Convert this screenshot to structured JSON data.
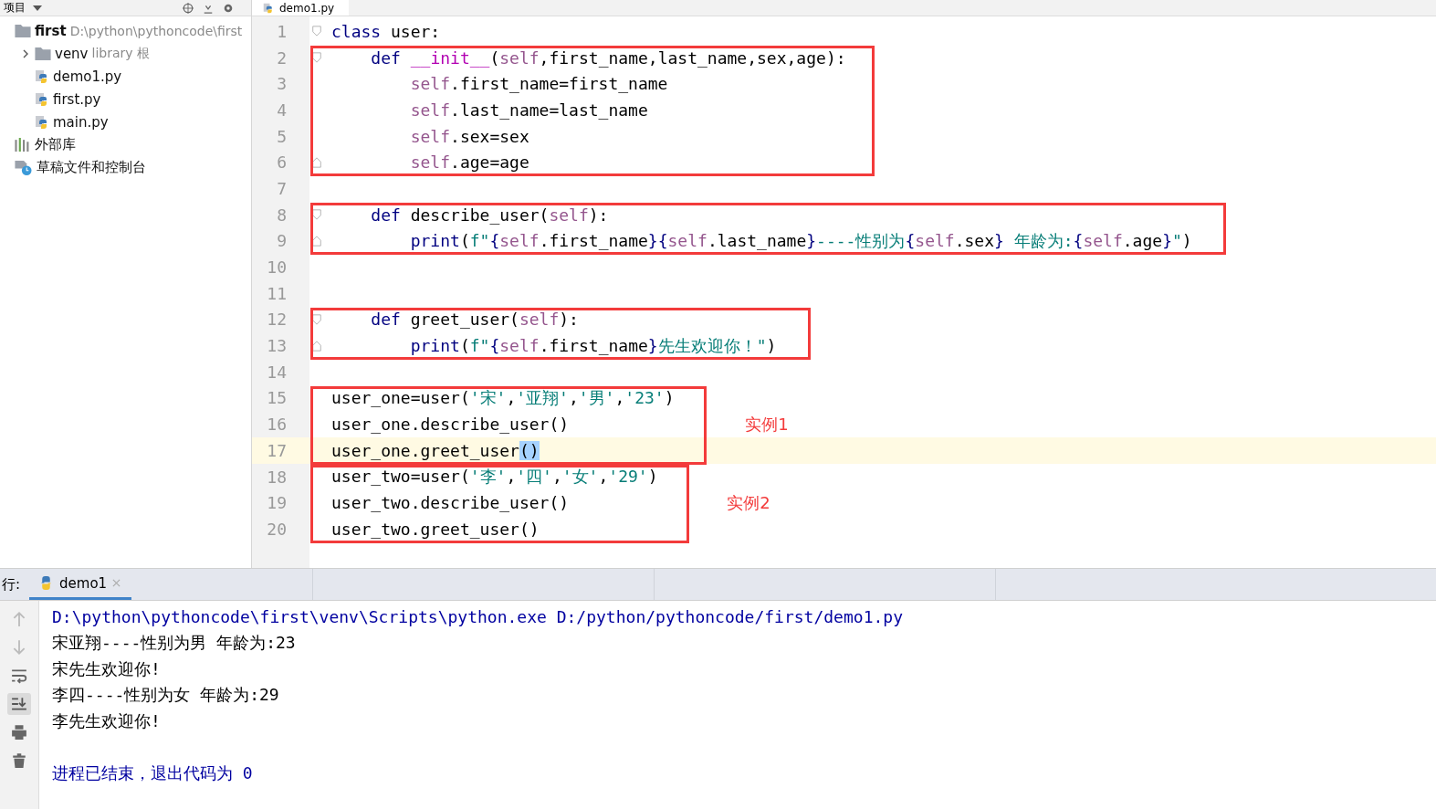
{
  "project_panel": {
    "title": "项目",
    "tree": [
      {
        "label": "first",
        "note": "D:\\python\\pythoncode\\first",
        "kind": "folder",
        "children": [
          {
            "label": "venv",
            "note": "library 根",
            "kind": "folder",
            "expanded": false
          },
          {
            "label": "demo1.py",
            "kind": "python"
          },
          {
            "label": "first.py",
            "kind": "python"
          },
          {
            "label": "main.py",
            "kind": "python"
          }
        ]
      },
      {
        "label": "外部库",
        "kind": "library"
      },
      {
        "label": "草稿文件和控制台",
        "kind": "scratch"
      }
    ]
  },
  "editor": {
    "tabs": [
      {
        "label": "demo1.py",
        "selected": true
      }
    ],
    "blocks": [
      {
        "kind": "plain",
        "lines": [
          {
            "number": "1",
            "kind": "fold-start",
            "current": false,
            "tokens": [
              {
                "t": "class",
                "kind": "kw"
              },
              {
                "t": " user:",
                "kind": "plain"
              }
            ]
          }
        ]
      },
      {
        "kind": "boxed",
        "lines": [
          {
            "number": "2",
            "kind": "fold-start",
            "current": false,
            "tokens": [
              {
                "t": "    def ",
                "kind": "kw"
              },
              {
                "t": "__init__",
                "kind": "magic"
              },
              {
                "t": "(",
                "kind": "plain"
              },
              {
                "t": "self",
                "kind": "self"
              },
              {
                "t": ",first_name,last_name,sex,age):",
                "kind": "plain"
              }
            ]
          },
          {
            "number": "3",
            "kind": "plain",
            "current": false,
            "tokens": [
              {
                "t": "        self",
                "kind": "self"
              },
              {
                "t": ".first_name=first_name",
                "kind": "plain"
              }
            ]
          },
          {
            "number": "4",
            "kind": "plain",
            "current": false,
            "tokens": [
              {
                "t": "        self",
                "kind": "self"
              },
              {
                "t": ".last_name=last_name",
                "kind": "plain"
              }
            ]
          },
          {
            "number": "5",
            "kind": "plain",
            "current": false,
            "tokens": [
              {
                "t": "        self",
                "kind": "self"
              },
              {
                "t": ".sex=sex",
                "kind": "plain"
              }
            ]
          },
          {
            "number": "6",
            "kind": "fold-end",
            "current": false,
            "tokens": [
              {
                "t": "        self",
                "kind": "self"
              },
              {
                "t": ".age=age",
                "kind": "plain"
              }
            ]
          }
        ]
      },
      {
        "kind": "plain",
        "lines": [
          {
            "number": "7",
            "kind": "plain",
            "current": false
          }
        ]
      },
      {
        "kind": "boxed",
        "lines": [
          {
            "number": "8",
            "kind": "fold-start",
            "current": false,
            "tokens": [
              {
                "t": "    def",
                "kind": "kw"
              },
              {
                "t": " describe_user(",
                "kind": "plain"
              },
              {
                "t": "self",
                "kind": "self"
              },
              {
                "t": "):",
                "kind": "plain"
              }
            ]
          },
          {
            "number": "9",
            "kind": "fold-end",
            "current": false,
            "tokens": [
              {
                "t": "        print",
                "kind": "builtin"
              },
              {
                "t": "(",
                "kind": "plain"
              },
              {
                "t": "f\"",
                "kind": "str"
              },
              {
                "t": "{",
                "kind": "brace"
              },
              {
                "t": "self",
                "kind": "self"
              },
              {
                "t": ".first_name",
                "kind": "plain"
              },
              {
                "t": "}{",
                "kind": "brace"
              },
              {
                "t": "self",
                "kind": "self"
              },
              {
                "t": ".last_name",
                "kind": "plain"
              },
              {
                "t": "}",
                "kind": "brace"
              },
              {
                "t": "----性别为",
                "kind": "str"
              },
              {
                "t": "{",
                "kind": "brace"
              },
              {
                "t": "self",
                "kind": "self"
              },
              {
                "t": ".sex",
                "kind": "plain"
              },
              {
                "t": "}",
                "kind": "brace"
              },
              {
                "t": " 年龄为:",
                "kind": "str"
              },
              {
                "t": "{",
                "kind": "brace"
              },
              {
                "t": "self",
                "kind": "self"
              },
              {
                "t": ".age",
                "kind": "plain"
              },
              {
                "t": "}",
                "kind": "brace"
              },
              {
                "t": "\"",
                "kind": "str"
              },
              {
                "t": ")",
                "kind": "plain"
              }
            ]
          }
        ]
      },
      {
        "kind": "plain",
        "lines": [
          {
            "number": "10",
            "kind": "plain",
            "current": false
          },
          {
            "number": "11",
            "kind": "plain",
            "current": false
          }
        ]
      },
      {
        "kind": "boxed",
        "lines": [
          {
            "number": "12",
            "kind": "fold-start",
            "current": false,
            "tokens": [
              {
                "t": "    def",
                "kind": "kw"
              },
              {
                "t": " greet_user(",
                "kind": "plain"
              },
              {
                "t": "self",
                "kind": "self"
              },
              {
                "t": "):",
                "kind": "plain"
              }
            ]
          },
          {
            "number": "13",
            "kind": "fold-end",
            "current": false,
            "tokens": [
              {
                "t": "        print",
                "kind": "builtin"
              },
              {
                "t": "(",
                "kind": "plain"
              },
              {
                "t": "f\"",
                "kind": "str"
              },
              {
                "t": "{",
                "kind": "brace"
              },
              {
                "t": "self",
                "kind": "self"
              },
              {
                "t": ".first_name",
                "kind": "plain"
              },
              {
                "t": "}",
                "kind": "brace"
              },
              {
                "t": "先生欢迎你！\"",
                "kind": "str"
              },
              {
                "t": ")",
                "kind": "plain"
              }
            ]
          }
        ]
      },
      {
        "kind": "plain",
        "lines": [
          {
            "number": "14",
            "kind": "plain",
            "current": false
          }
        ]
      },
      {
        "kind": "boxed",
        "label": "实例1",
        "lines": [
          {
            "number": "15",
            "kind": "plain",
            "current": false,
            "tokens": [
              {
                "t": "user_one=user(",
                "kind": "plain"
              },
              {
                "t": "'宋'",
                "kind": "str"
              },
              {
                "t": ",",
                "kind": "plain"
              },
              {
                "t": "'亚翔'",
                "kind": "str"
              },
              {
                "t": ",",
                "kind": "plain"
              },
              {
                "t": "'男'",
                "kind": "str"
              },
              {
                "t": ",",
                "kind": "plain"
              },
              {
                "t": "'23'",
                "kind": "str"
              },
              {
                "t": ")",
                "kind": "plain"
              }
            ]
          },
          {
            "number": "16",
            "kind": "plain",
            "current": false,
            "tokens": [
              {
                "t": "user_one.describe_user()",
                "kind": "plain"
              }
            ]
          },
          {
            "number": "17",
            "kind": "plain",
            "current": true,
            "tokens": [
              {
                "t": "user_one.greet_user",
                "kind": "plain"
              },
              {
                "t": "()",
                "kind": "selection"
              }
            ]
          }
        ]
      },
      {
        "kind": "boxed",
        "label": "实例2",
        "lines": [
          {
            "number": "18",
            "kind": "plain",
            "current": false,
            "tokens": [
              {
                "t": "user_two=user(",
                "kind": "plain"
              },
              {
                "t": "'李'",
                "kind": "str"
              },
              {
                "t": ",",
                "kind": "plain"
              },
              {
                "t": "'四'",
                "kind": "str"
              },
              {
                "t": ",",
                "kind": "plain"
              },
              {
                "t": "'女'",
                "kind": "str"
              },
              {
                "t": ",",
                "kind": "plain"
              },
              {
                "t": "'29'",
                "kind": "str"
              },
              {
                "t": ")",
                "kind": "plain"
              }
            ]
          },
          {
            "number": "19",
            "kind": "plain",
            "current": false,
            "tokens": [
              {
                "t": "user_two.describe_user()",
                "kind": "plain"
              }
            ]
          },
          {
            "number": "20",
            "kind": "plain",
            "current": false,
            "tokens": [
              {
                "t": "user_two.greet_user()",
                "kind": "plain"
              }
            ]
          }
        ]
      }
    ]
  },
  "run_panel": {
    "title": "行:",
    "tabs": [
      {
        "label": "demo1",
        "selected": true
      }
    ],
    "toolbar": [
      {
        "kind": "up",
        "selected": false
      },
      {
        "kind": "down",
        "selected": false
      },
      {
        "kind": "wrap",
        "selected": false
      },
      {
        "kind": "scroll-end",
        "selected": true
      },
      {
        "kind": "print",
        "selected": false
      },
      {
        "kind": "trash",
        "selected": false
      }
    ],
    "output": [
      {
        "kind": "command",
        "text": "D:\\python\\pythoncode\\first\\venv\\Scripts\\python.exe D:/python/pythoncode/first/demo1.py"
      },
      {
        "kind": "stdout",
        "text": "宋亚翔----性别为男 年龄为:23"
      },
      {
        "kind": "stdout",
        "text": "宋先生欢迎你!"
      },
      {
        "kind": "stdout",
        "text": "李四----性别为女 年龄为:29"
      },
      {
        "kind": "stdout",
        "text": "李先生欢迎你!"
      },
      {
        "kind": "blank"
      },
      {
        "kind": "exit",
        "text": "进程已结束，退出代码为 0"
      }
    ]
  }
}
